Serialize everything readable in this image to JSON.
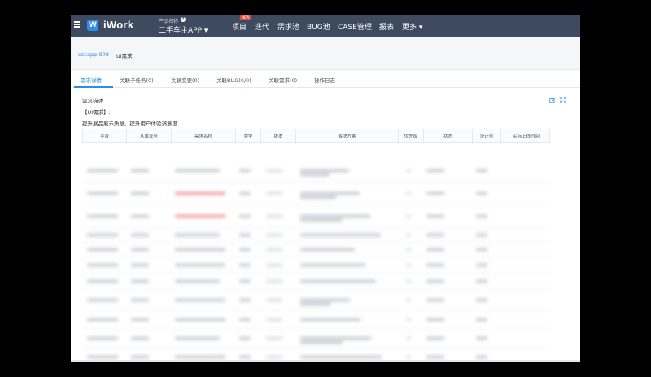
{
  "app": {
    "logo_glyph": "W",
    "name": "iWork",
    "product_label": "产品名称",
    "product_info_glyph": "?",
    "product_name": "二手车主APP ▾"
  },
  "nav": {
    "items": [
      "项目",
      "迭代",
      "需求池",
      "BUG池",
      "CASE管理",
      "报表",
      "更多 ▾"
    ],
    "new_badge": "NEW"
  },
  "breadcrumb": {
    "project": "escapp-908",
    "current": "UI需求"
  },
  "tabs": {
    "detail": "需求详情",
    "subtasks": "关联子任务(0)",
    "changes": "关联变更(0)",
    "bug_prefix": "关联BUG(",
    "bug_count": "0",
    "bug_suffix": "/0)",
    "related": "关联需求(0)",
    "log": "操作日志",
    "active_color": "#2d8cf0"
  },
  "content": {
    "section_title": "需求描述",
    "req_tag": "【UI需求】:",
    "req_desc": "提升展品展示质量、提升用户体验满意度"
  },
  "table": {
    "headers": [
      "平台",
      "从属业务",
      "需求名称",
      "类型",
      "版本",
      "解决方案",
      "优先级",
      "状态",
      "设计师",
      "实际上线时间"
    ]
  },
  "icons": {
    "edit": "edit-icon",
    "fullscreen": "fullscreen-icon",
    "menu": "hamburger-icon"
  }
}
